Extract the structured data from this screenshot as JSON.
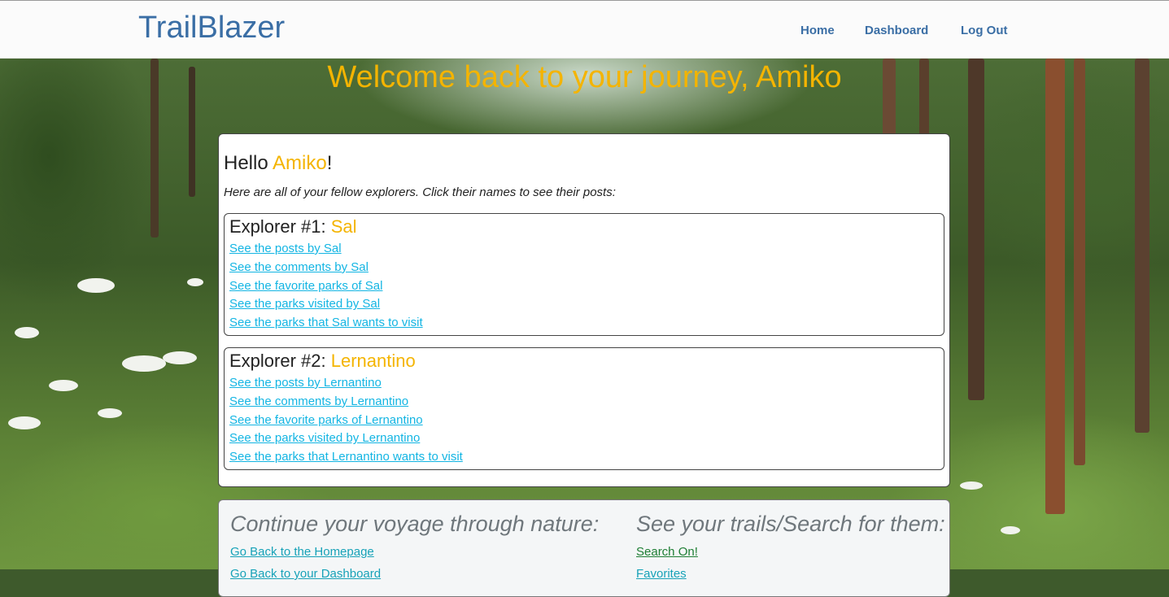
{
  "navbar": {
    "brand": "TrailBlazer",
    "links": [
      "Home",
      "Dashboard",
      "Log Out"
    ]
  },
  "welcome": "Welcome back to your journey, Amiko",
  "card": {
    "hello_prefix": "Hello ",
    "user": "Amiko",
    "hello_suffix": "!",
    "intro": "Here are all of your fellow explorers. Click their names to see their posts:",
    "explorers": [
      {
        "title_prefix": "Explorer #1: ",
        "name": "Sal",
        "links": [
          "See the posts by Sal",
          "See the comments by Sal",
          "See the favorite parks of Sal",
          "See the parks visited by Sal",
          "See the parks that Sal wants to visit"
        ]
      },
      {
        "title_prefix": "Explorer #2: ",
        "name": "Lernantino",
        "links": [
          "See the posts by Lernantino",
          "See the comments by Lernantino",
          "See the favorite parks of Lernantino",
          "See the parks visited by Lernantino",
          "See the parks that Lernantino wants to visit"
        ]
      }
    ]
  },
  "footer": {
    "left_heading": "Continue your voyage through nature:",
    "left_links": [
      "Go Back to the Homepage",
      "Go Back to your Dashboard"
    ],
    "right_heading": "See your trails/Search for them:",
    "right_links": [
      "Search On!",
      "Favorites"
    ]
  },
  "colors": {
    "brand_blue": "#3a6ea5",
    "accent_yellow": "#f4b400",
    "link_cyan": "#13b5e3"
  }
}
